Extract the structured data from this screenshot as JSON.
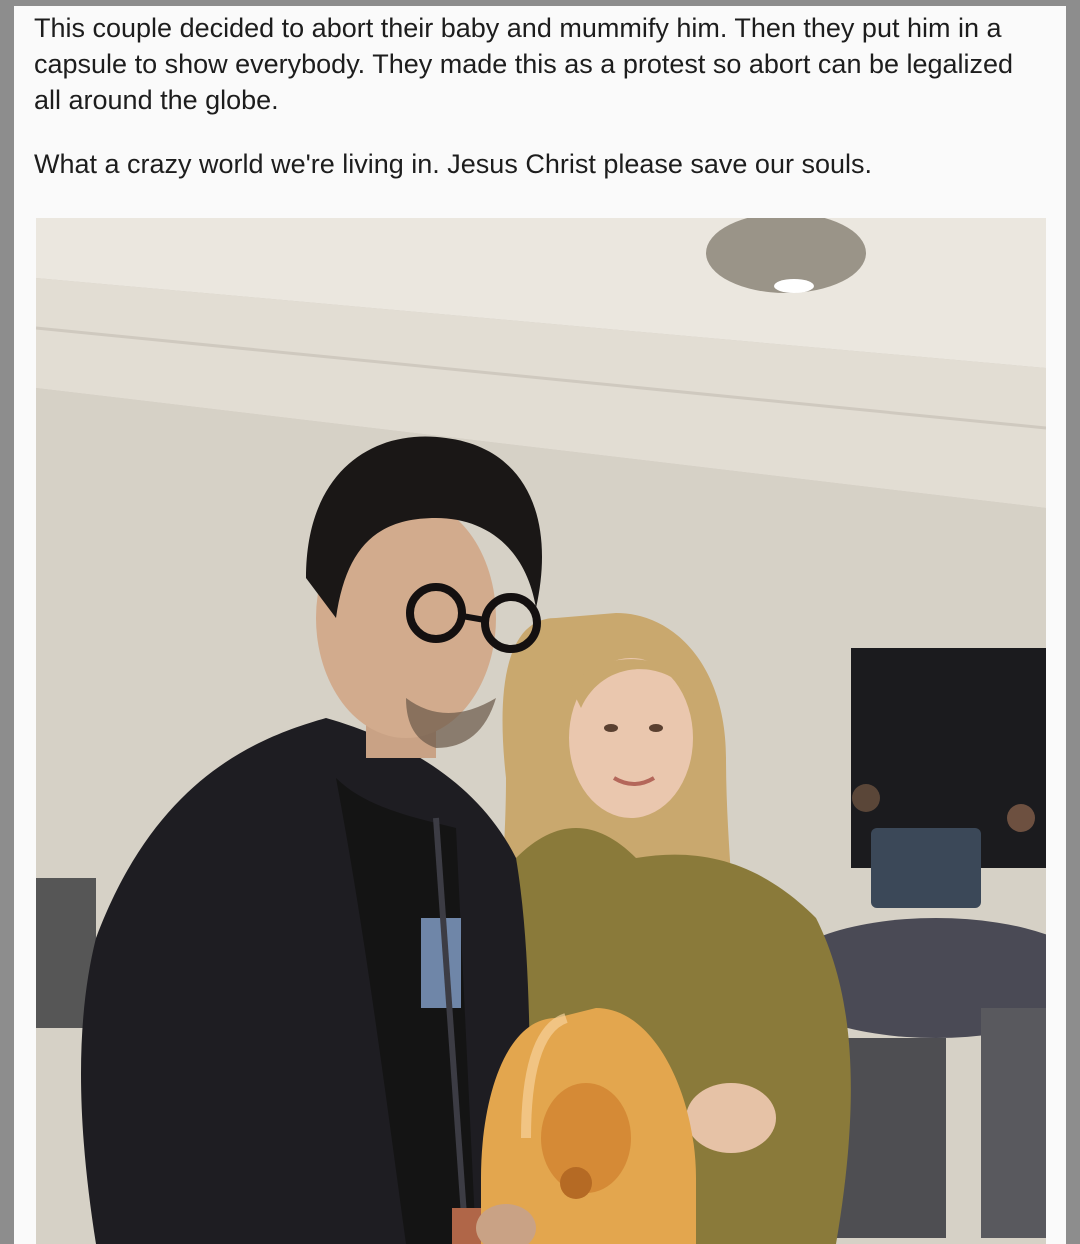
{
  "post": {
    "paragraph_1": "This couple decided to abort their baby and mummify him. Then they put him in a capsule to show everybody. They made this as a protest so abort can be legalized all around the globe.",
    "paragraph_2": "What a crazy world we're living in. Jesus Christ please save our souls."
  },
  "photo": {
    "subject": "two people posing in a conference room holding an orange capsule figurine",
    "colors": {
      "wall": "#d6d1c6",
      "ceiling": "#ebe7df",
      "jacket": "#1e1d22",
      "dress": "#8a7a3a",
      "hair_woman": "#c9a86e",
      "hair_man": "#1a1716",
      "capsule": "#e3a64e"
    }
  }
}
